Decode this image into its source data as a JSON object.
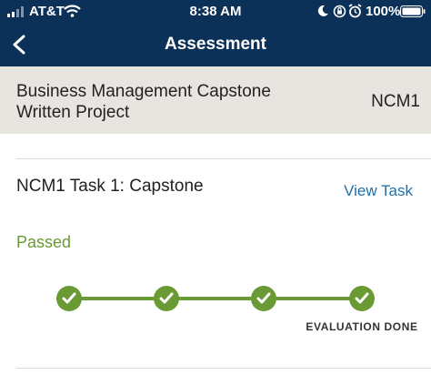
{
  "status_bar": {
    "carrier": "AT&T",
    "time": "8:38 AM",
    "battery": "100%"
  },
  "nav": {
    "title": "Assessment",
    "back_icon": "chevron-left-icon"
  },
  "course": {
    "name": "Business Management Capstone Written Project",
    "code": "NCM1"
  },
  "task": {
    "title": "NCM1 Task 1: Capstone",
    "view_link": "View Task",
    "status": "Passed"
  },
  "progress": {
    "steps_completed": 4,
    "steps_total": 4,
    "current_label": "EVALUATION DONE"
  },
  "colors": {
    "header_bg": "#0c3158",
    "course_bg": "#e8e5e0",
    "success": "#6a9a34",
    "link": "#1f6fa6"
  }
}
